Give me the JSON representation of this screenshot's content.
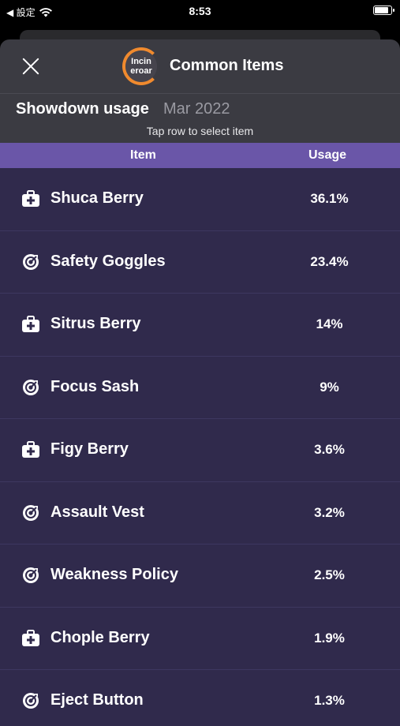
{
  "status_bar": {
    "back_label": "◀ 設定",
    "time": "8:53"
  },
  "header": {
    "avatar_text": "Incin eroar",
    "title": "Common Items"
  },
  "subheader": {
    "format": "Showdown usage",
    "date": "Mar 2022",
    "hint": "Tap row to select item"
  },
  "columns": {
    "item": "Item",
    "usage": "Usage"
  },
  "items": [
    {
      "name": "Shuca Berry",
      "usage": "36.1%",
      "icon": "medkit-icon"
    },
    {
      "name": "Safety Goggles",
      "usage": "23.4%",
      "icon": "target-icon"
    },
    {
      "name": "Sitrus Berry",
      "usage": "14%",
      "icon": "medkit-icon"
    },
    {
      "name": "Focus Sash",
      "usage": "9%",
      "icon": "target-icon"
    },
    {
      "name": "Figy Berry",
      "usage": "3.6%",
      "icon": "medkit-icon"
    },
    {
      "name": "Assault Vest",
      "usage": "3.2%",
      "icon": "target-icon"
    },
    {
      "name": "Weakness Policy",
      "usage": "2.5%",
      "icon": "target-icon"
    },
    {
      "name": "Chople Berry",
      "usage": "1.9%",
      "icon": "medkit-icon"
    },
    {
      "name": "Eject Button",
      "usage": "1.3%",
      "icon": "target-icon"
    }
  ],
  "colors": {
    "accent": "#6a56a8",
    "avatar_ring": "#f08a2e",
    "list_bg": "#302a4c"
  }
}
